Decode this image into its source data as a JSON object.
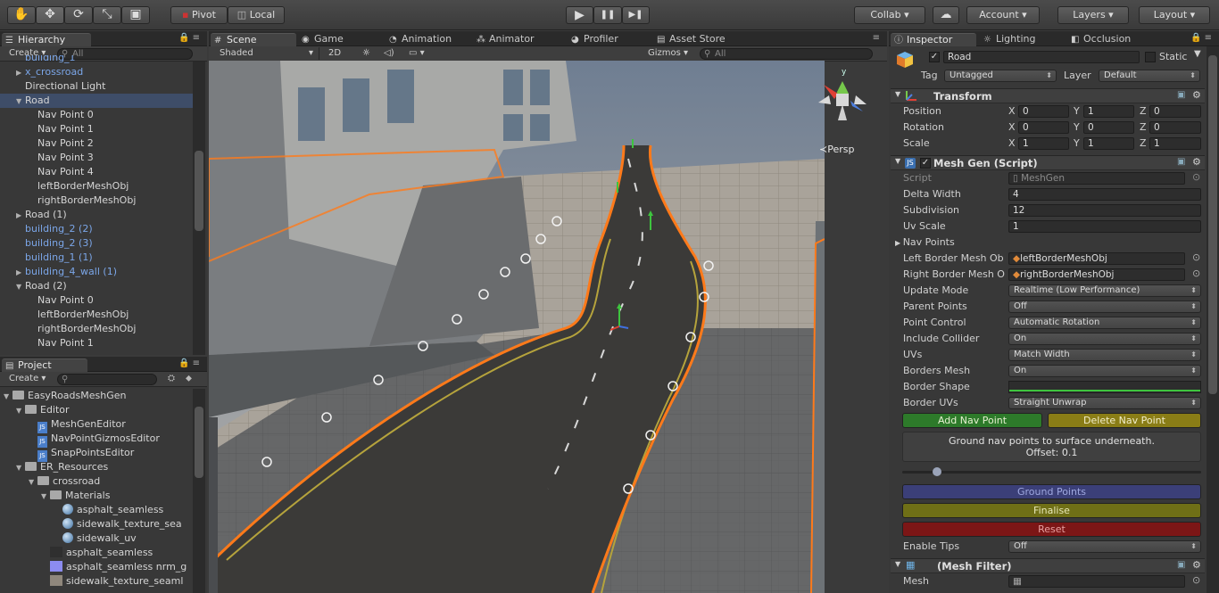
{
  "toolbar": {
    "tools": [
      {
        "name": "hand-tool-icon",
        "glyph": "✋"
      },
      {
        "name": "move-tool-icon",
        "glyph": "✥"
      },
      {
        "name": "rotate-tool-icon",
        "glyph": "⟳"
      },
      {
        "name": "scale-tool-icon",
        "glyph": "⤡"
      },
      {
        "name": "rect-tool-icon",
        "glyph": "▣"
      }
    ],
    "pivot_label": "Pivot",
    "local_label": "Local",
    "play_glyph": "▶",
    "pause_glyph": "❚❚",
    "step_glyph": "▶❚",
    "collab_label": "Collab ▾",
    "cloud_glyph": "☁",
    "account_label": "Account",
    "layers_label": "Layers",
    "layout_label": "Layout"
  },
  "hierarchy": {
    "tab_label": "Hierarchy",
    "create_label": "Create ▾",
    "search_placeholder": "All",
    "items": [
      {
        "label": "building_1",
        "indent": 2,
        "fold": "",
        "blue": true,
        "selected": false
      },
      {
        "label": "x_crossroad",
        "indent": 2,
        "fold": "▶",
        "blue": true,
        "selected": false
      },
      {
        "label": "Directional Light",
        "indent": 2,
        "fold": "",
        "blue": false,
        "selected": false
      },
      {
        "label": "Road",
        "indent": 2,
        "fold": "▼",
        "blue": false,
        "selected": true
      },
      {
        "label": "Nav Point 0",
        "indent": 3,
        "fold": "",
        "blue": false,
        "selected": false
      },
      {
        "label": "Nav Point 1",
        "indent": 3,
        "fold": "",
        "blue": false,
        "selected": false
      },
      {
        "label": "Nav Point 2",
        "indent": 3,
        "fold": "",
        "blue": false,
        "selected": false
      },
      {
        "label": "Nav Point 3",
        "indent": 3,
        "fold": "",
        "blue": false,
        "selected": false
      },
      {
        "label": "Nav Point 4",
        "indent": 3,
        "fold": "",
        "blue": false,
        "selected": false
      },
      {
        "label": "leftBorderMeshObj",
        "indent": 3,
        "fold": "",
        "blue": false,
        "selected": false
      },
      {
        "label": "rightBorderMeshObj",
        "indent": 3,
        "fold": "",
        "blue": false,
        "selected": false
      },
      {
        "label": "Road (1)",
        "indent": 2,
        "fold": "▶",
        "blue": false,
        "selected": false
      },
      {
        "label": "building_2 (2)",
        "indent": 2,
        "fold": "",
        "blue": true,
        "selected": false
      },
      {
        "label": "building_2 (3)",
        "indent": 2,
        "fold": "",
        "blue": true,
        "selected": false
      },
      {
        "label": "building_1 (1)",
        "indent": 2,
        "fold": "",
        "blue": true,
        "selected": false
      },
      {
        "label": "building_4_wall (1)",
        "indent": 2,
        "fold": "▶",
        "blue": true,
        "selected": false
      },
      {
        "label": "Road (2)",
        "indent": 2,
        "fold": "▼",
        "blue": false,
        "selected": false
      },
      {
        "label": "Nav Point 0",
        "indent": 3,
        "fold": "",
        "blue": false,
        "selected": false
      },
      {
        "label": "leftBorderMeshObj",
        "indent": 3,
        "fold": "",
        "blue": false,
        "selected": false
      },
      {
        "label": "rightBorderMeshObj",
        "indent": 3,
        "fold": "",
        "blue": false,
        "selected": false
      },
      {
        "label": "Nav Point 1",
        "indent": 3,
        "fold": "",
        "blue": false,
        "selected": false
      }
    ]
  },
  "project": {
    "tab_label": "Project",
    "create_label": "Create ▾",
    "items": [
      {
        "label": "EasyRoadsMeshGen",
        "indent": 0,
        "fold": "▼",
        "icon": "folder"
      },
      {
        "label": "Editor",
        "indent": 1,
        "fold": "▼",
        "icon": "folder"
      },
      {
        "label": "MeshGenEditor",
        "indent": 2,
        "fold": "",
        "icon": "script"
      },
      {
        "label": "NavPointGizmosEditor",
        "indent": 2,
        "fold": "",
        "icon": "script"
      },
      {
        "label": "SnapPointsEditor",
        "indent": 2,
        "fold": "",
        "icon": "script"
      },
      {
        "label": "ER_Resources",
        "indent": 1,
        "fold": "▼",
        "icon": "folder"
      },
      {
        "label": "crossroad",
        "indent": 2,
        "fold": "▼",
        "icon": "folder"
      },
      {
        "label": "Materials",
        "indent": 3,
        "fold": "▼",
        "icon": "folder"
      },
      {
        "label": "asphalt_seamless",
        "indent": 4,
        "fold": "",
        "icon": "material"
      },
      {
        "label": "sidewalk_texture_sea",
        "indent": 4,
        "fold": "",
        "icon": "material"
      },
      {
        "label": "sidewalk_uv",
        "indent": 4,
        "fold": "",
        "icon": "material"
      },
      {
        "label": "asphalt_seamless",
        "indent": 3,
        "fold": "",
        "icon": "texture-dark"
      },
      {
        "label": "asphalt_seamless nrm_g",
        "indent": 3,
        "fold": "",
        "icon": "texture-normal"
      },
      {
        "label": "sidewalk_texture_seaml",
        "indent": 3,
        "fold": "",
        "icon": "texture-sidewalk"
      }
    ]
  },
  "scene": {
    "tabs": [
      {
        "label": "Scene",
        "icon": "#",
        "active": true
      },
      {
        "label": "Game",
        "icon": "◉",
        "active": false
      },
      {
        "label": "Animation",
        "icon": "◔",
        "active": false
      },
      {
        "label": "Animator",
        "icon": "⁂",
        "active": false
      },
      {
        "label": "Profiler",
        "icon": "◕",
        "active": false
      },
      {
        "label": "Asset Store",
        "icon": "▤",
        "active": false
      }
    ],
    "shading_label": "Shaded",
    "mode_2d_label": "2D",
    "gizmos_label": "Gizmos ▾",
    "search_placeholder": "All",
    "persp_label": "≺Persp"
  },
  "inspector": {
    "tabs": [
      {
        "label": "Inspector",
        "icon": "ⓘ",
        "active": true
      },
      {
        "label": "Lighting",
        "icon": "☼",
        "active": false
      },
      {
        "label": "Occlusion",
        "icon": "◧",
        "active": false
      }
    ],
    "object_name": "Road",
    "static_label": "Static",
    "tag_label": "Tag",
    "tag_value": "Untagged",
    "layer_label": "Layer",
    "layer_value": "Default",
    "transform": {
      "title": "Transform",
      "rows": [
        {
          "label": "Position",
          "x": "0",
          "y": "1",
          "z": "0"
        },
        {
          "label": "Rotation",
          "x": "0",
          "y": "0",
          "z": "0"
        },
        {
          "label": "Scale",
          "x": "1",
          "y": "1",
          "z": "1"
        }
      ],
      "axis_x": "X",
      "axis_y": "Y",
      "axis_z": "Z"
    },
    "meshgen": {
      "title": "Mesh Gen (Script)",
      "script_label": "Script",
      "script_value": "MeshGen",
      "delta_width_label": "Delta Width",
      "delta_width_value": "4",
      "subdivision_label": "Subdivision",
      "subdivision_value": "12",
      "uv_scale_label": "Uv Scale",
      "uv_scale_value": "1",
      "nav_points_label": "Nav Points",
      "left_border_label": "Left Border Mesh Ob",
      "left_border_value": "leftBorderMeshObj",
      "right_border_label": "Right Border Mesh O",
      "right_border_value": "rightBorderMeshObj",
      "dropdowns": [
        {
          "label": "Update Mode",
          "value": "Realtime (Low Performance)"
        },
        {
          "label": "Parent Points",
          "value": "Off"
        },
        {
          "label": "Point Control",
          "value": "Automatic Rotation"
        },
        {
          "label": "Include Collider",
          "value": "On"
        },
        {
          "label": "UVs",
          "value": "Match Width"
        },
        {
          "label": "Borders Mesh",
          "value": "On"
        }
      ],
      "border_shape_label": "Border Shape",
      "border_uvs_label": "Border UVs",
      "border_uvs_value": "Straight Unwrap",
      "add_nav_point_label": "Add Nav Point",
      "delete_nav_point_label": "Delete Nav Point",
      "info_line1": "Ground nav points to surface underneath.",
      "info_line2": "Offset: 0.1",
      "offset_slider_fraction": 0.1,
      "ground_points_label": "Ground Points",
      "finalise_label": "Finalise",
      "reset_label": "Reset",
      "enable_tips_label": "Enable Tips",
      "enable_tips_value": "Off"
    },
    "meshfilter": {
      "title": "(Mesh Filter)",
      "mesh_label": "Mesh"
    }
  },
  "colors": {
    "selection_outline": "#ff7a1a",
    "add_button": "#2d7a2a",
    "delete_button": "#8a7d16",
    "ground_button": "#3b3f78",
    "finalise_button": "#6f6f16",
    "reset_button": "#7c1616"
  }
}
